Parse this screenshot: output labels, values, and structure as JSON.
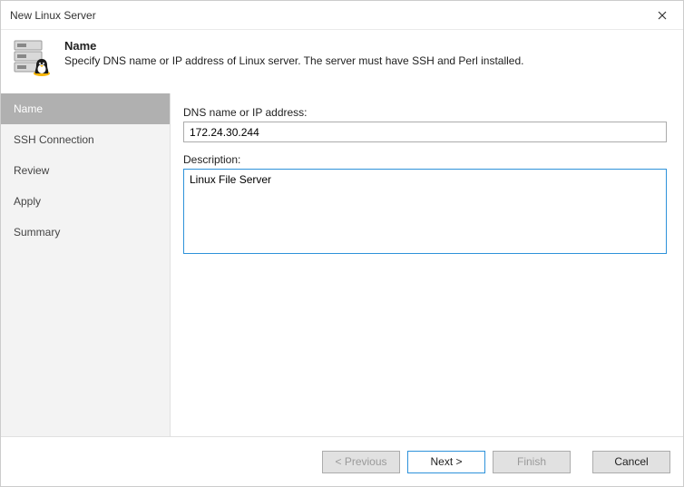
{
  "window": {
    "title": "New Linux Server"
  },
  "header": {
    "title": "Name",
    "subtitle": "Specify DNS name or IP address of Linux server. The server must have SSH and Perl installed."
  },
  "sidebar": {
    "items": [
      {
        "label": "Name",
        "active": true
      },
      {
        "label": "SSH Connection",
        "active": false
      },
      {
        "label": "Review",
        "active": false
      },
      {
        "label": "Apply",
        "active": false
      },
      {
        "label": "Summary",
        "active": false
      }
    ]
  },
  "form": {
    "dns_label": "DNS name or IP address:",
    "dns_value": "172.24.30.244",
    "description_label": "Description:",
    "description_value": "Linux File Server"
  },
  "footer": {
    "previous": "< Previous",
    "next": "Next >",
    "finish": "Finish",
    "cancel": "Cancel"
  }
}
